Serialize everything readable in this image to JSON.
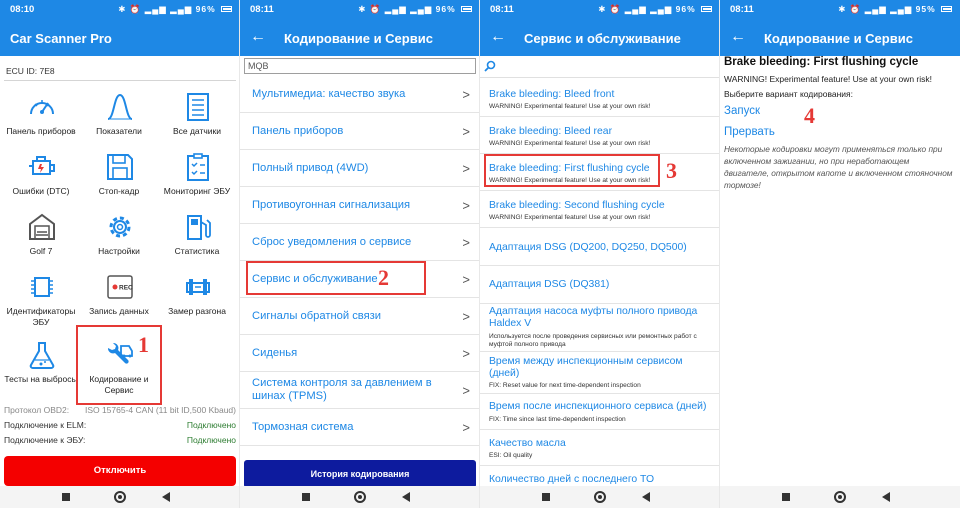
{
  "colors": {
    "primary": "#1e88e5",
    "danger_button": "#f40000",
    "history_button": "#0d1b9e",
    "connected": "#2e7d32",
    "annotation": "#e53935"
  },
  "screens": [
    {
      "status": {
        "time": "08:10",
        "battery": "96"
      },
      "appbar": {
        "title": "Car Scanner Pro"
      },
      "ecu_id": "ECU ID: 7E8",
      "tiles": [
        {
          "label": "Панель приборов",
          "icon": "gauge-icon"
        },
        {
          "label": "Показатели",
          "icon": "graph-icon"
        },
        {
          "label": "Все датчики",
          "icon": "list-icon"
        },
        {
          "label": "Ошибки (DTC)",
          "icon": "engine-icon"
        },
        {
          "label": "Стоп-кадр",
          "icon": "floppy-icon"
        },
        {
          "label": "Мониторинг ЭБУ",
          "icon": "clipboard-check-icon"
        },
        {
          "label": "Golf 7",
          "icon": "garage-icon"
        },
        {
          "label": "Настройки",
          "icon": "gear-icon"
        },
        {
          "label": "Статистика",
          "icon": "fuel-pump-icon"
        },
        {
          "label": "Идентификаторы ЭБУ",
          "icon": "chip-icon"
        },
        {
          "label": "Запись данных",
          "icon": "record-icon"
        },
        {
          "label": "Замер разгона",
          "icon": "race-car-icon"
        },
        {
          "label": "Тесты на выбросы",
          "icon": "flask-icon"
        },
        {
          "label": "Кодирование и Сервис",
          "icon": "wrench-car-icon"
        }
      ],
      "annotation_number": "1",
      "info": [
        {
          "label": "Протокол OBD2:",
          "value": "ISO 15765-4 CAN (11 bit ID,500 Kbaud)"
        },
        {
          "label": "Подключение к ELM:",
          "value": "Подключено"
        },
        {
          "label": "Подключение к ЭБУ:",
          "value": "Подключено"
        }
      ],
      "disconnect_label": "Отключить"
    },
    {
      "status": {
        "time": "08:11",
        "battery": "96"
      },
      "appbar": {
        "title": "Кодирование и Сервис"
      },
      "search_value": "MQB",
      "items": [
        "Мультимедиа: качество звука",
        "Панель приборов",
        "Полный привод (4WD)",
        "Противоугонная сигнализация",
        "Сброс уведомления о сервисе",
        "Сервис и обслуживание",
        "Сигналы обратной связи",
        "Сиденья",
        "Система контроля за давлением в шинах (TPMS)",
        "Тормозная система"
      ],
      "chevron": ">",
      "annotation_number": "2",
      "history_label": "История кодирования"
    },
    {
      "status": {
        "time": "08:11",
        "battery": "96"
      },
      "appbar": {
        "title": "Сервис и обслуживание"
      },
      "items": [
        {
          "title": "Brake bleeding: Bleed front",
          "desc": "WARNING! Experimental feature! Use at your own risk!"
        },
        {
          "title": "Brake bleeding: Bleed rear",
          "desc": "WARNING! Experimental feature! Use at your own risk!"
        },
        {
          "title": "Brake bleeding: First flushing cycle",
          "desc": "WARNING! Experimental feature! Use at your own risk!"
        },
        {
          "title": "Brake bleeding: Second flushing cycle",
          "desc": "WARNING! Experimental feature! Use at your own risk!"
        },
        {
          "title": "Адаптация DSG (DQ200, DQ250, DQ500)",
          "desc": ""
        },
        {
          "title": "Адаптация DSG (DQ381)",
          "desc": ""
        },
        {
          "title": "Адаптация насоса муфты полного привода",
          "title2": "Haldex V",
          "desc": "Используется после проведения сервисных или ремонтных работ с",
          "desc2": "муфтой полного привода"
        },
        {
          "title": "Время между инспекционным сервисом",
          "title2": "(дней)",
          "desc": "FIX: Reset value for next time-dependent inspection"
        },
        {
          "title": "Время после инспекционного сервиса (дней)",
          "desc": "FIX: Time since last time-dependent inspection"
        },
        {
          "title": "Качество масла",
          "desc": "ESI: Oil quality"
        },
        {
          "title": "Количество дней с последнего ТО",
          "desc": ""
        }
      ],
      "annotation_number": "3"
    },
    {
      "status": {
        "time": "08:11",
        "battery": "95"
      },
      "appbar": {
        "title": "Кодирование и Сервис"
      },
      "heading": "Brake bleeding: First flushing cycle",
      "warning": "WARNING! Experimental feature! Use at your own risk!",
      "choose": "Выберите вариант кодирования:",
      "start_label": "Запуск",
      "abort_label": "Прервать",
      "note": "Некоторые кодировки могут применяться только при включенном зажигании, но при неработающем двигателе, открытом капоте и включенном стояночном тормозе!",
      "annotation_number": "4"
    }
  ]
}
